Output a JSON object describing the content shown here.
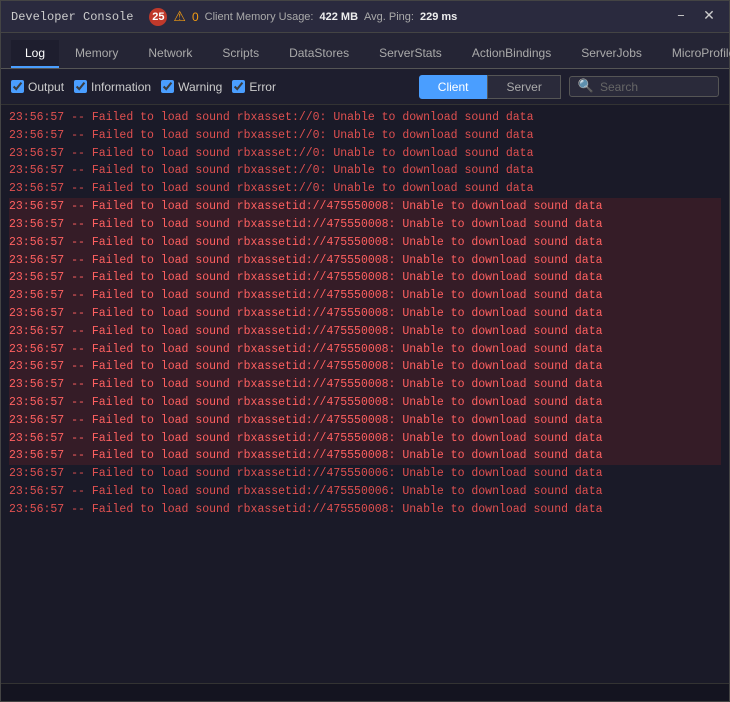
{
  "titleBar": {
    "title": "Developer Console",
    "errorCount": "25",
    "warningCount": "0",
    "memoryLabel": "Client Memory Usage:",
    "memoryValue": "422 MB",
    "pingLabel": "Avg. Ping:",
    "pingValue": "229 ms"
  },
  "navTabs": [
    {
      "id": "log",
      "label": "Log",
      "active": true
    },
    {
      "id": "memory",
      "label": "Memory",
      "active": false
    },
    {
      "id": "network",
      "label": "Network",
      "active": false
    },
    {
      "id": "scripts",
      "label": "Scripts",
      "active": false
    },
    {
      "id": "datastores",
      "label": "DataStores",
      "active": false
    },
    {
      "id": "serverstats",
      "label": "ServerStats",
      "active": false
    },
    {
      "id": "actionbindings",
      "label": "ActionBindings",
      "active": false
    },
    {
      "id": "serverjobs",
      "label": "ServerJobs",
      "active": false
    },
    {
      "id": "microprofiler",
      "label": "MicroProfiler",
      "active": false
    }
  ],
  "toolbar": {
    "output": "Output",
    "information": "Information",
    "warning": "Warning",
    "error": "Error",
    "clientBtn": "Client",
    "serverBtn": "Server",
    "searchPlaceholder": "Search"
  },
  "logLines": [
    {
      "text": "23:56:57  --  Failed to load sound rbxasset://0: Unable to download sound data",
      "highlight": false
    },
    {
      "text": "23:56:57  --  Failed to load sound rbxasset://0: Unable to download sound data",
      "highlight": false
    },
    {
      "text": "23:56:57  --  Failed to load sound rbxasset://0: Unable to download sound data",
      "highlight": false
    },
    {
      "text": "23:56:57  --  Failed to load sound rbxasset://0: Unable to download sound data",
      "highlight": false
    },
    {
      "text": "23:56:57  --  Failed to load sound rbxasset://0: Unable to download sound data",
      "highlight": false
    },
    {
      "text": "23:56:57  --  Failed to load sound rbxassetid://475550008: Unable to download sound data",
      "highlight": true
    },
    {
      "text": "23:56:57  --  Failed to load sound rbxassetid://475550008: Unable to download sound data",
      "highlight": true
    },
    {
      "text": "23:56:57  --  Failed to load sound rbxassetid://475550008: Unable to download sound data",
      "highlight": true
    },
    {
      "text": "23:56:57  --  Failed to load sound rbxassetid://475550008: Unable to download sound data",
      "highlight": true
    },
    {
      "text": "23:56:57  --  Failed to load sound rbxassetid://475550008: Unable to download sound data",
      "highlight": true
    },
    {
      "text": "23:56:57  --  Failed to load sound rbxassetid://475550008: Unable to download sound data",
      "highlight": true
    },
    {
      "text": "23:56:57  --  Failed to load sound rbxassetid://475550008: Unable to download sound data",
      "highlight": true
    },
    {
      "text": "23:56:57  --  Failed to load sound rbxassetid://475550008: Unable to download sound data",
      "highlight": true
    },
    {
      "text": "23:56:57  --  Failed to load sound rbxassetid://475550008: Unable to download sound data",
      "highlight": true
    },
    {
      "text": "23:56:57  --  Failed to load sound rbxassetid://475550008: Unable to download sound data",
      "highlight": true
    },
    {
      "text": "23:56:57  --  Failed to load sound rbxassetid://475550008: Unable to download sound data",
      "highlight": true
    },
    {
      "text": "23:56:57  --  Failed to load sound rbxassetid://475550008: Unable to download sound data",
      "highlight": true
    },
    {
      "text": "23:56:57  --  Failed to load sound rbxassetid://475550008: Unable to download sound data",
      "highlight": true
    },
    {
      "text": "23:56:57  --  Failed to load sound rbxassetid://475550008: Unable to download sound data",
      "highlight": true
    },
    {
      "text": "23:56:57  --  Failed to load sound rbxassetid://475550008: Unable to download sound data",
      "highlight": true
    },
    {
      "text": "23:56:57  --  Failed to load sound rbxassetid://475550006: Unable to download sound data",
      "highlight": false
    },
    {
      "text": "23:56:57  --  Failed to load sound rbxassetid://475550006: Unable to download sound data",
      "highlight": false
    },
    {
      "text": "23:56:57  --  Failed to load sound rbxassetid://475550008: Unable to download sound data",
      "highlight": false
    }
  ]
}
